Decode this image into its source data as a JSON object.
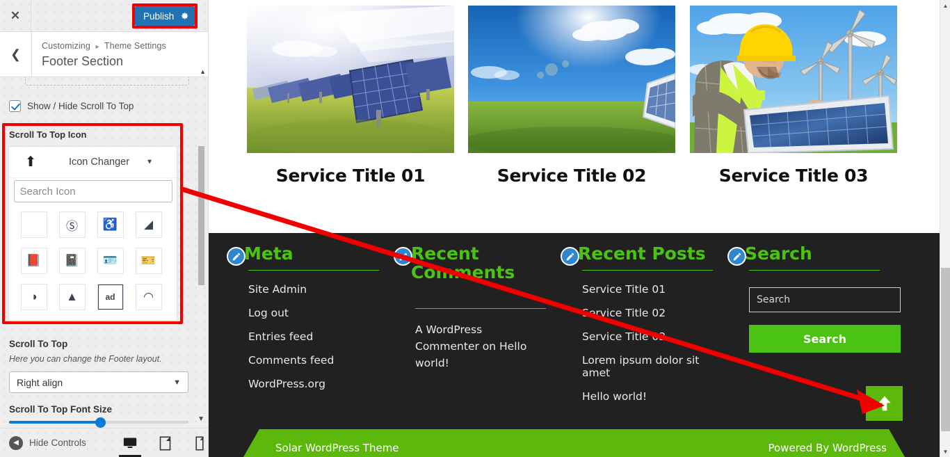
{
  "customizer": {
    "close_icon": "close-icon",
    "publish_label": "Publish",
    "gear_icon": "gear-icon",
    "back_icon": "chevron-left-icon",
    "breadcrumb": {
      "root": "Customizing",
      "separator": "▸",
      "current": "Theme Settings"
    },
    "panel_title": "Footer Section",
    "controls": {
      "show_hide_label": "Show / Hide Scroll To Top",
      "show_hide_checked": true,
      "icon_section_label": "Scroll To Top Icon",
      "current_icon_glyph": "⬆",
      "icon_changer_label": "Icon Changer",
      "icon_search_placeholder": "Search Icon",
      "icon_grid": [
        {
          "name": "blank-icon",
          "glyph": ""
        },
        {
          "name": "500px-icon",
          "glyph": "Ⓢ"
        },
        {
          "name": "accessible-icon",
          "glyph": "♿"
        },
        {
          "name": "accusoft-icon",
          "glyph": "◢"
        },
        {
          "name": "address-book-solid-icon",
          "glyph": "📕"
        },
        {
          "name": "address-book-regular-icon",
          "glyph": "📓"
        },
        {
          "name": "address-card-solid-icon",
          "glyph": "🪪"
        },
        {
          "name": "address-card-regular-icon",
          "glyph": "🎫"
        },
        {
          "name": "adjust-icon",
          "glyph": "◑"
        },
        {
          "name": "arrow-alt-circle-up-icon",
          "glyph": "▲"
        },
        {
          "name": "ad-icon",
          "glyph": "ad"
        },
        {
          "name": "adn-icon",
          "glyph": "◠"
        },
        {
          "name": "blank-icon",
          "glyph": ""
        },
        {
          "name": "blank-icon",
          "glyph": ""
        },
        {
          "name": "blank-icon",
          "glyph": ""
        },
        {
          "name": "blank-icon",
          "glyph": ""
        }
      ],
      "scroll_to_top_label": "Scroll To Top",
      "scroll_to_top_desc": "Here you can change the Footer layout.",
      "align_value": "Right align",
      "font_size_label": "Scroll To Top Font Size",
      "font_size_percent": 51
    },
    "footer": {
      "hide_controls_label": "Hide Controls",
      "devices": [
        {
          "name": "desktop-view-button",
          "active": true
        },
        {
          "name": "tablet-view-button",
          "active": false
        },
        {
          "name": "mobile-view-button",
          "active": false
        }
      ]
    }
  },
  "preview": {
    "services": [
      {
        "title": "Service Title 01",
        "image": "solar-panel-field-image"
      },
      {
        "title": "Service Title 02",
        "image": "wind-turbine-solar-panel-image"
      },
      {
        "title": "Service Title 03",
        "image": "worker-installing-solar-panel-image"
      }
    ],
    "footer_widgets": [
      {
        "title": "Meta",
        "type": "list",
        "items": [
          "Site Admin",
          "Log out",
          "Entries feed",
          "Comments feed",
          "WordPress.org"
        ]
      },
      {
        "title": "Recent Comments",
        "type": "text",
        "text": "A WordPress Commenter on Hello world!"
      },
      {
        "title": "Recent Posts",
        "type": "list",
        "items": [
          "Service Title 01",
          "Service Title 02",
          "Service Title 03",
          "Lorem ipsum dolor sit amet",
          "Hello world!"
        ]
      },
      {
        "title": "Search",
        "type": "search",
        "search_placeholder": "Search",
        "search_button_label": "Search"
      }
    ],
    "scroll_top_button": {
      "name": "scroll-to-top-button",
      "glyph": "⬆"
    },
    "bottom_bar": {
      "left": "Solar WordPress Theme",
      "right": "Powered By WordPress"
    }
  },
  "annotation": {
    "highlight_color": "#f20000",
    "arrow_color": "#f20000"
  },
  "colors": {
    "accent_green": "#4bc312",
    "button_green": "#5cb80a",
    "wp_blue": "#2271b1",
    "footer_dark": "#212121"
  }
}
